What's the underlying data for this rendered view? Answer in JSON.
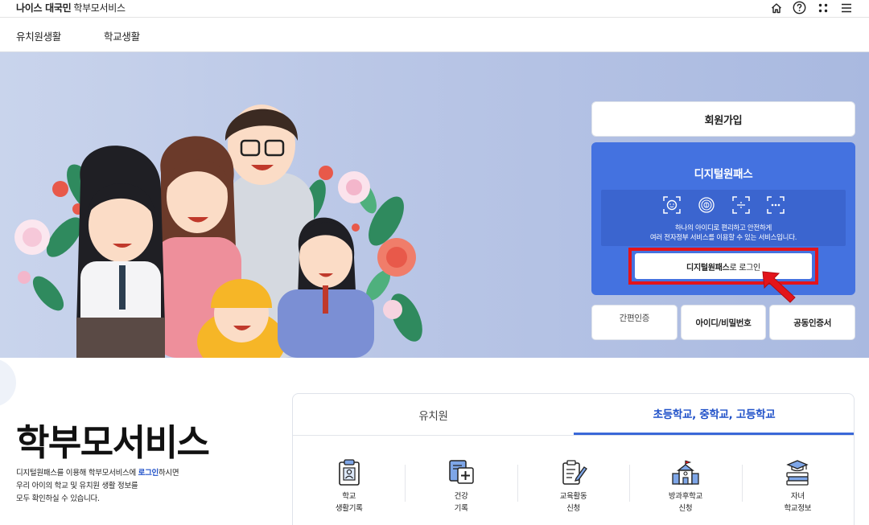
{
  "header": {
    "brand_strong": "나이스 대국민",
    "brand_light": "학부모서비스",
    "icons": [
      "home-icon",
      "help-icon",
      "apps-icon",
      "menu-icon"
    ]
  },
  "nav": {
    "items": [
      {
        "label": "유치원생활"
      },
      {
        "label": "학교생활"
      }
    ]
  },
  "login": {
    "join_label": "회원가입",
    "digital_pass_title": "디지털원패스",
    "auth_icons": [
      "face-auth-icon",
      "fingerprint-icon",
      "scan-icon",
      "pin-icon"
    ],
    "desc_line1": "하나의 아이디로 편리하고 안전하게",
    "desc_line2": "여러 전자정부 서비스를 이용할 수 있는 서비스입니다.",
    "login_btn_strong": "디지털원패스",
    "login_btn_rest": "로 로그인",
    "alt_methods": [
      {
        "label": "간편인증"
      },
      {
        "label": "아이디/비밀번호"
      },
      {
        "label": "공동인증서"
      }
    ]
  },
  "service": {
    "title": "학부모서비스",
    "desc_pre": "디지털원패스를 이용해 학부모서비스에 ",
    "desc_link": "로그인",
    "desc_post": "하시면",
    "desc_line2": "우리 아이의 학교 및 유치원 생활 정보를",
    "desc_line3": "모두 확인하실 수 있습니다.",
    "tabs": [
      {
        "label": "유치원",
        "active": false
      },
      {
        "label": "초등학교, 중학교, 고등학교",
        "active": true
      }
    ],
    "items": [
      {
        "line1": "학교",
        "line2": "생활기록",
        "icon": "school-record-icon"
      },
      {
        "line1": "건강",
        "line2": "기록",
        "icon": "health-record-icon"
      },
      {
        "line1": "교육활동",
        "line2": "신청",
        "icon": "activity-apply-icon"
      },
      {
        "line1": "방과후학교",
        "line2": "신청",
        "icon": "afterschool-icon"
      },
      {
        "line1": "자녀",
        "line2": "학교정보",
        "icon": "child-school-info-icon"
      }
    ]
  },
  "colors": {
    "accent": "#2152c9",
    "panel_blue": "#4472e0",
    "highlight_red": "#e3141b"
  }
}
